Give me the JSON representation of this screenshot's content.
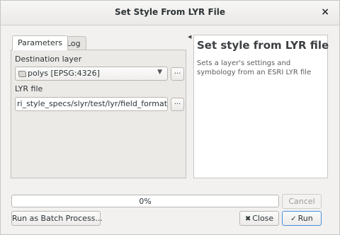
{
  "window": {
    "title": "Set Style From LYR File",
    "close_glyph": "×"
  },
  "tabs": [
    {
      "label": "Parameters",
      "active": true
    },
    {
      "label": "Log",
      "active": false
    }
  ],
  "parameters": {
    "destination_layer": {
      "label": "Destination layer",
      "value": "polys [EPSG:4326]",
      "icon": "polygon-layer-icon",
      "browse_label": "..."
    },
    "lyr_file": {
      "label": "LYR file",
      "value": "ri_style_specs/slyr/test/lyr/field_formats.lyr",
      "browse_label": "..."
    }
  },
  "help": {
    "title": "Set style from LYR file",
    "description": "Sets a layer's settings and symbology from an ESRI LYR file"
  },
  "progress": {
    "value": 0,
    "text": "0%"
  },
  "buttons": {
    "cancel": {
      "label": "Cancel",
      "enabled": false
    },
    "batch": {
      "label": "Run as Batch Process..."
    },
    "close": {
      "label": "Close",
      "icon": "close-x-icon"
    },
    "run": {
      "label": "Run",
      "icon": "checkmark-icon"
    }
  },
  "colors": {
    "accent": "#4a90d9",
    "window_bg": "#f2f1f0"
  }
}
